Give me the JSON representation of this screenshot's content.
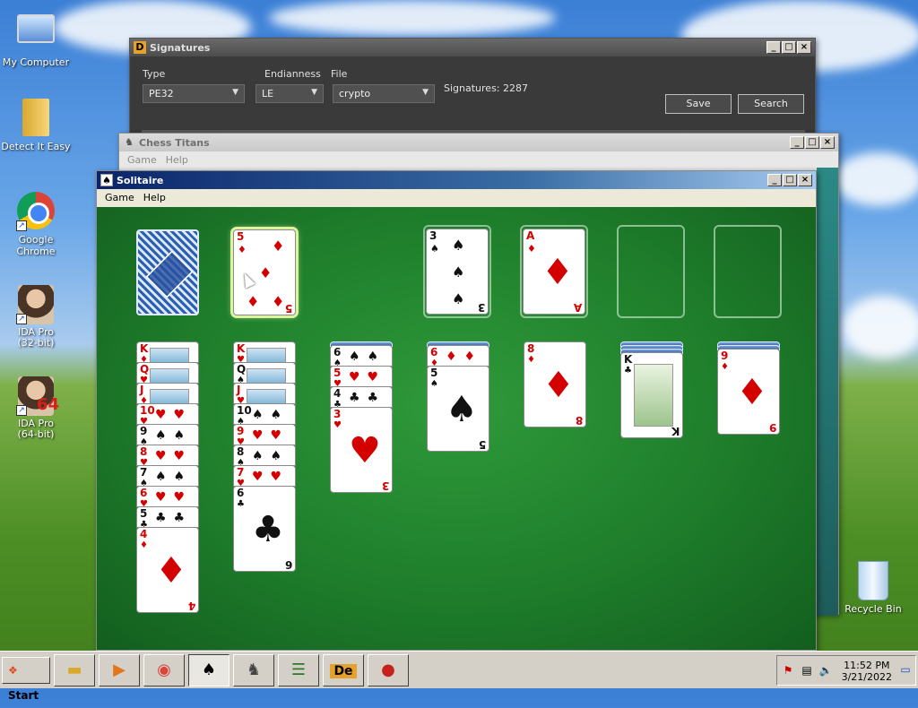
{
  "desktop": {
    "icons": [
      {
        "label": "My Computer",
        "icon": "computer-icon"
      },
      {
        "label": "Detect It Easy",
        "icon": "folder-icon"
      },
      {
        "label": "Google Chrome",
        "icon": "chrome-icon"
      },
      {
        "label": "IDA Pro\n(32-bit)",
        "icon": "ida-icon"
      },
      {
        "label": "IDA Pro\n(64-bit)",
        "icon": "ida64-icon",
        "badge": "64"
      },
      {
        "label": "Recycle Bin",
        "icon": "recycle-bin-icon"
      }
    ]
  },
  "signatures_window": {
    "title": "Signatures",
    "type_label": "Type",
    "type_value": "PE32",
    "endianness_label": "Endianness",
    "endianness_value": "LE",
    "file_label": "File",
    "file_value": "crypto",
    "count_text": "Signatures: 2287",
    "save_label": "Save",
    "search_label": "Search"
  },
  "chess_window": {
    "title": "Chess Titans",
    "menu": [
      "Game",
      "Help"
    ]
  },
  "solitaire_window": {
    "title": "Solitaire",
    "menu": [
      "Game",
      "Help"
    ],
    "stock": "face-down",
    "waste": {
      "rank": "5",
      "suit": "♦"
    },
    "foundations": [
      {
        "rank": "3",
        "suit": "♠"
      },
      {
        "rank": "A",
        "suit": "♦"
      },
      {
        "rank": "",
        "suit": ""
      },
      {
        "rank": "",
        "suit": ""
      }
    ],
    "tableau": [
      {
        "cards": [
          "K♦",
          "Q♥",
          "J♦",
          "10♥",
          "9♠",
          "8♥",
          "7♠",
          "6♥",
          "5♣",
          "4♦"
        ]
      },
      {
        "cards": [
          "K♥",
          "Q♠",
          "J♥",
          "10♠",
          "9♥",
          "8♠",
          "7♥",
          "6♣"
        ]
      },
      {
        "down": 1,
        "cards": [
          "6♠",
          "5♥",
          "4♣",
          "3♥"
        ]
      },
      {
        "down": 1,
        "cards": [
          "6♦",
          "5♠"
        ]
      },
      {
        "cards": [
          "8♦"
        ]
      },
      {
        "down": 3,
        "cards": [
          "K♣"
        ]
      },
      {
        "down": 2,
        "cards": [
          "9♦"
        ]
      }
    ]
  },
  "taskbar": {
    "start_label": "Start",
    "apps": [
      "file-explorer-icon",
      "media-player-icon",
      "chrome-icon",
      "solitaire-icon",
      "chess-icon",
      "list-icon",
      "die-icon",
      "ida-red-icon"
    ],
    "active_app": "solitaire-icon",
    "clock_time": "11:52 PM",
    "clock_date": "3/21/2022"
  }
}
